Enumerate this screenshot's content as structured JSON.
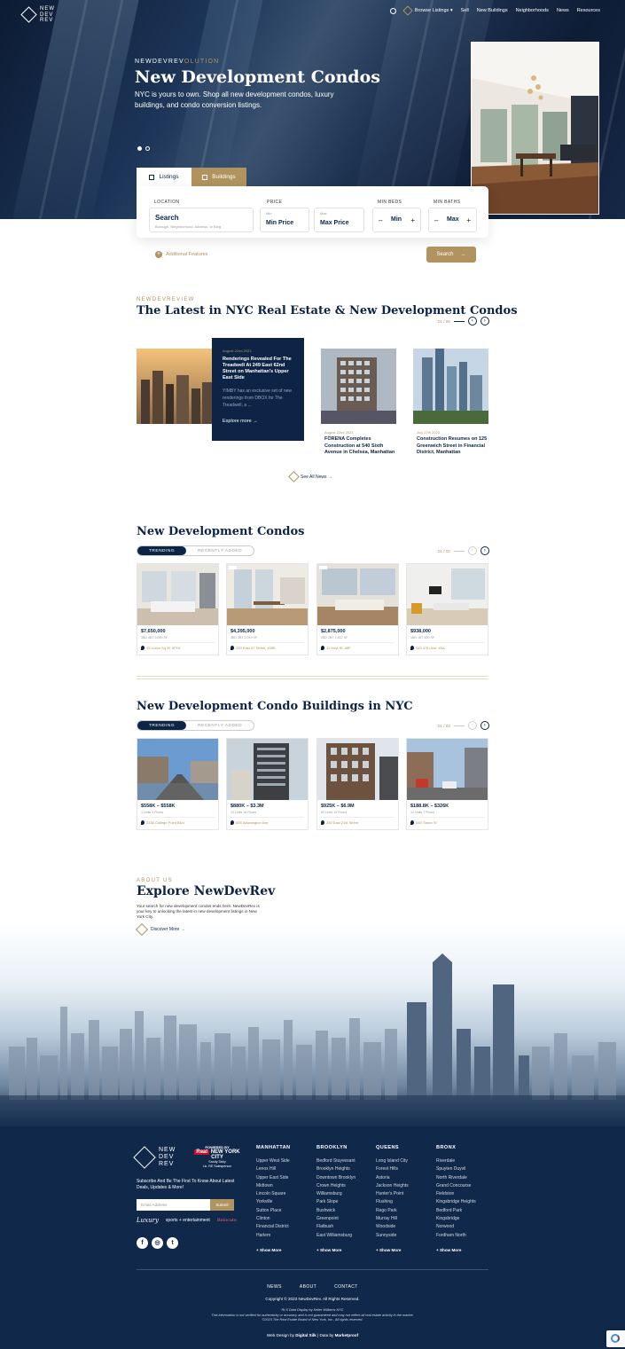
{
  "brand": {
    "logo_lines": [
      "NEW",
      "DEV",
      "REV"
    ]
  },
  "nav": {
    "items": [
      "Browse Listings ▾",
      "Sell",
      "New Buildings",
      "Neighborhoods",
      "News",
      "Resources"
    ]
  },
  "hero": {
    "kicker": "NEWDEVREVOLUTION",
    "kicker_bold": "NEWDEVREV",
    "kicker_rest": "OLUTION",
    "title": "New Development Condos",
    "subtitle": "NYC is yours to own. Shop all new development condos, luxury buildings, and condo conversion listings."
  },
  "search": {
    "tabs": [
      "Listings",
      "Buildings"
    ],
    "location": {
      "label": "LOCATION",
      "value": "Search",
      "hint": "Borough, Neighborhood, Address, or Bldg"
    },
    "price": {
      "label": "PRICE",
      "min_small": "Min",
      "min": "Min Price",
      "max_small": "Max",
      "max": "Max Price"
    },
    "beds": {
      "label": "MIN BEDS",
      "value": "Min"
    },
    "baths": {
      "label": "MIN BATHS",
      "value": "Max"
    },
    "additional": "Additional Features",
    "button": "Search"
  },
  "news": {
    "kicker": "NEWDEVREVIEW",
    "title": "The Latest in NYC Real Estate & New Development Condos",
    "pager": "01 / 06",
    "featured": {
      "date": "August 22nd 2023",
      "title": "Renderings Revealed For The Treadwell At 249 East 62nd Street on Manhattan's Upper East Side",
      "excerpt": "YIMBY has an exclusive set of new renderings from DBOX for The Treadwell, a ...",
      "more": "Explore more →"
    },
    "cards": [
      {
        "date": "August 22nd 2023",
        "title": "FÖRENA Completes Construction at 540 Sixth Avenue in Chelsea, Manhattan"
      },
      {
        "date": "July 27th 2023",
        "title": "Construction Resumes on 125 Greenwich Street in Financial District, Manhattan"
      }
    ],
    "see_all": "See All News →"
  },
  "condos": {
    "title": "New Development Condos",
    "toggle": [
      "TRENDING",
      "RECENTLY ADDED"
    ],
    "pager": "01 / 02",
    "cards": [
      {
        "price": "$7,650,000",
        "meta": "3BD 4BT 3,000 SF",
        "addr": "15 Union Sq W, #PH1"
      },
      {
        "price": "$4,395,000",
        "meta": "3BD 3BT 2,019 SF",
        "addr": "250 East 57 Street, #39E"
      },
      {
        "price": "$2,875,000",
        "meta": "2BD 2BT 1,452 SF",
        "addr": "11 Hoyt St, #8F"
      },
      {
        "price": "$938,000",
        "meta": "1BD 1BT 600 SF",
        "addr": "545 47th Ave, #3A"
      }
    ]
  },
  "buildings": {
    "title": "New Development Condo Buildings in NYC",
    "toggle": [
      "TRENDING",
      "RECENTLY ADDED"
    ],
    "pager": "01 / 03",
    "cards": [
      {
        "price": "$558K – $558K",
        "meta": "1 Units 3 Floors",
        "addr": "2336 College Point Blvd"
      },
      {
        "price": "$880K – $3.3M",
        "meta": "14 Units 16 Floors",
        "addr": "855 Washington Ave"
      },
      {
        "price": "$925K – $6.9M",
        "meta": "52 Units 14 Floors",
        "addr": "250 East 21st Street"
      },
      {
        "price": "$188.8K – $326K",
        "meta": "12 Units 7 Floors",
        "addr": "840 Tinton St"
      }
    ]
  },
  "about": {
    "kicker": "ABOUT US",
    "title": "Explore NewDevRev",
    "text": "Your search for new development condos ends here. NewDevRev is your key to unlocking the latest in new development listings in New York City.",
    "cta": "Discover More →"
  },
  "footer": {
    "logo_lines": [
      "NEW",
      "DEV",
      "REV"
    ],
    "powered": {
      "line1": "POWERED BY",
      "brand_a": "Real",
      "brand_b": "NEW YORK CITY",
      "line3": "Sandy Sidry",
      "line4": "Lic. RE Salesperson"
    },
    "subscribe": "Subscribe And Be The First To Know About Latest Deals, Updates & More!",
    "email_placeholder": "Email Address",
    "submit": "Submit",
    "brand_logos": [
      "Luxury",
      "sports + entertainment",
      "Relocate"
    ],
    "socials": [
      "f",
      "◎",
      "t"
    ],
    "columns": [
      {
        "head": "MANHATTAN",
        "items": [
          "Upper West Side",
          "Lenox Hill",
          "Upper East Side",
          "Midtown",
          "Lincoln Square",
          "Yorkville",
          "Sutton Place",
          "Clinton",
          "Financial District",
          "Harlem"
        ],
        "more": "+ Show More"
      },
      {
        "head": "BROOKLYN",
        "items": [
          "Bedford Stuyvesant",
          "Brooklyn Heights",
          "Downtown Brooklyn",
          "Crown Heights",
          "Williamsburg",
          "Park Slope",
          "Bushwick",
          "Greenpoint",
          "Flatbush",
          "East Williamsburg"
        ],
        "more": "+ Show More"
      },
      {
        "head": "QUEENS",
        "items": [
          "Long Island City",
          "Forest Hills",
          "Astoria",
          "Jackson Heights",
          "Hunter's Point",
          "Flushing",
          "Rego Park",
          "Murray Hill",
          "Woodside",
          "Sunnyside"
        ],
        "more": "+ Show More"
      },
      {
        "head": "BRONX",
        "items": [
          "Riverdale",
          "Spuyten Duyvil",
          "North Riverdale",
          "Grand Concourse",
          "Fieldston",
          "Kingsbridge Heights",
          "Bedford Park",
          "Kingsbridge",
          "Norwood",
          "Fordham North"
        ],
        "more": "+ Show More"
      }
    ],
    "links": [
      "NEWS",
      "ABOUT",
      "CONTACT"
    ],
    "copyright": "Copyright © 2023 NewDevRev. All Rights Reserved.",
    "disclaimer1": "RLS Data Display by Keller Williams NYC",
    "disclaimer2": "This information is not verified for authenticity or accuracy and is not guaranteed and may not reflect all real estate activity in the market.",
    "disclaimer3": "©2023 The Real Estate Board of New York, Inc., All rights reserved.",
    "credits_a": "Web Design by",
    "credits_b": "Digital Silk",
    "credits_c": "| Data by",
    "credits_d": "Marketproof"
  },
  "colors": {
    "navy": "#0e2446",
    "gold": "#b0935e",
    "footer": "#10284a"
  }
}
